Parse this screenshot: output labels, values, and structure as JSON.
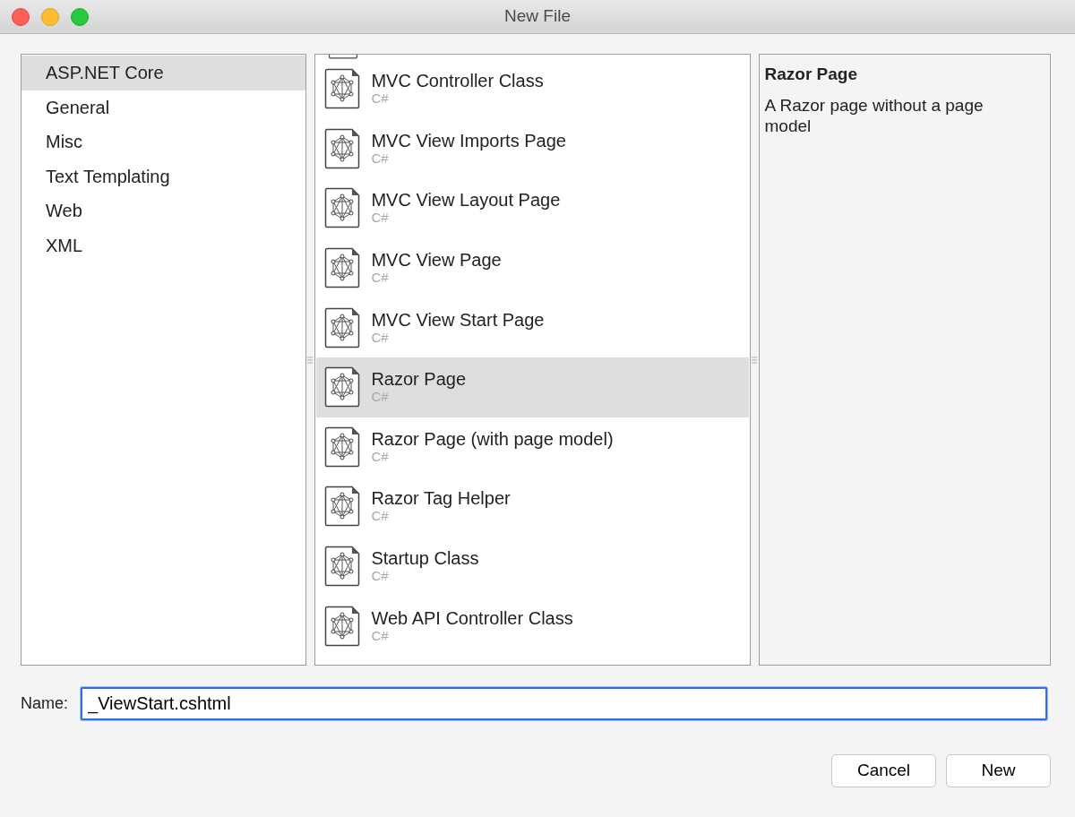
{
  "window": {
    "title": "New File"
  },
  "categories": [
    {
      "label": "ASP.NET Core",
      "selected": true
    },
    {
      "label": "General",
      "selected": false
    },
    {
      "label": "Misc",
      "selected": false
    },
    {
      "label": "Text Templating",
      "selected": false
    },
    {
      "label": "Web",
      "selected": false
    },
    {
      "label": "XML",
      "selected": false
    }
  ],
  "templates": [
    {
      "name": "MVC Controller Class",
      "language": "C#",
      "selected": false
    },
    {
      "name": "MVC View Imports Page",
      "language": "C#",
      "selected": false
    },
    {
      "name": "MVC View Layout Page",
      "language": "C#",
      "selected": false
    },
    {
      "name": "MVC View Page",
      "language": "C#",
      "selected": false
    },
    {
      "name": "MVC View Start Page",
      "language": "C#",
      "selected": false
    },
    {
      "name": "Razor Page",
      "language": "C#",
      "selected": true
    },
    {
      "name": "Razor Page (with page model)",
      "language": "C#",
      "selected": false
    },
    {
      "name": "Razor Tag Helper",
      "language": "C#",
      "selected": false
    },
    {
      "name": "Startup Class",
      "language": "C#",
      "selected": false
    },
    {
      "name": "Web API Controller Class",
      "language": "C#",
      "selected": false
    }
  ],
  "description": {
    "title": "Razor Page",
    "text": "A Razor page without a page model"
  },
  "name_field": {
    "label": "Name:",
    "value": "_ViewStart.cshtml"
  },
  "buttons": [
    {
      "label": "Cancel"
    },
    {
      "label": "New"
    }
  ]
}
